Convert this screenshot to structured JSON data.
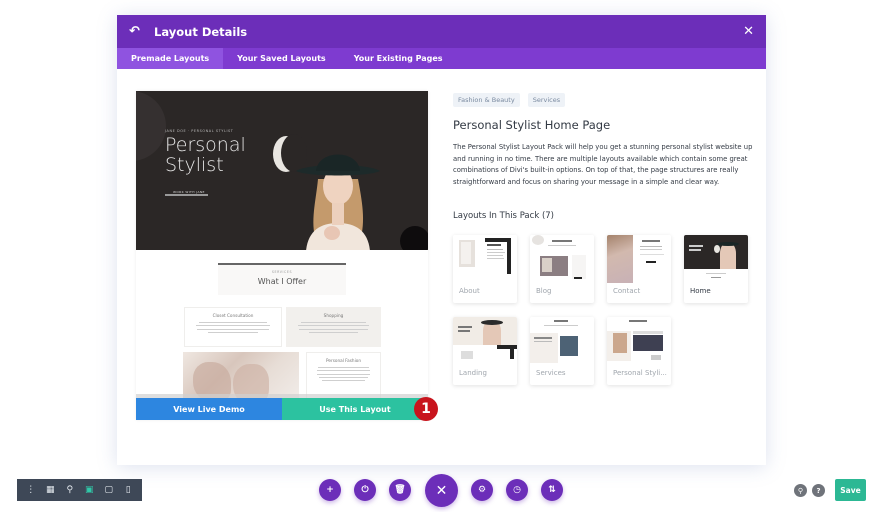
{
  "modal": {
    "title": "Layout Details",
    "back_icon": "back-arrow-icon",
    "close_icon": "close-icon",
    "tabs": [
      {
        "label": "Premade Layouts",
        "active": true
      },
      {
        "label": "Your Saved Layouts",
        "active": false
      },
      {
        "label": "Your Existing Pages",
        "active": false
      }
    ]
  },
  "preview": {
    "hero": {
      "kicker": "JANE DOE · PERSONAL STYLIST",
      "heading_line1": "Personal",
      "heading_line2": "Stylist",
      "cta": "WORK WITH JANE"
    },
    "services": {
      "kicker": "SERVICES",
      "heading": "What I Offer",
      "cards": [
        {
          "title": "Closet Consultation"
        },
        {
          "title": "Shopping"
        },
        {
          "title": "Personal Fashion"
        }
      ]
    },
    "buttons": {
      "view_demo": "View Live Demo",
      "use_layout": "Use This Layout"
    },
    "step_badge": "1"
  },
  "details": {
    "tags": [
      "Fashion & Beauty",
      "Services"
    ],
    "title": "Personal Stylist Home Page",
    "description": "The Personal Stylist Layout Pack will help you get a stunning personal stylist website up and running in no time. There are multiple layouts available which contain some great combinations of Divi's built-in options. On top of that, the page structures are really straightforward and focus on sharing your message in a simple and clear way.",
    "pack_title": "Layouts In This Pack (7)",
    "layouts": [
      {
        "label": "About",
        "active": false
      },
      {
        "label": "Blog",
        "active": false
      },
      {
        "label": "Contact",
        "active": false
      },
      {
        "label": "Home",
        "active": true
      },
      {
        "label": "Landing",
        "active": false
      },
      {
        "label": "Services",
        "active": false
      },
      {
        "label": "Personal Styli...",
        "active": false
      }
    ]
  },
  "bottom_bar": {
    "device_icons": [
      "more-vertical-icon",
      "wireframe-icon",
      "zoom-icon",
      "desktop-icon",
      "tablet-icon",
      "phone-icon"
    ],
    "active_device": "desktop-icon",
    "action_icons": [
      "add-icon",
      "power-icon",
      "trash-icon",
      "close-icon",
      "gear-icon",
      "history-icon",
      "sort-icon"
    ],
    "help_icons": [
      "search-icon",
      "help-icon"
    ],
    "save_label": "Save"
  },
  "colors": {
    "header_purple": "#6c2eb9",
    "tabs_purple": "#7e3bd0",
    "demo_blue": "#2d86e0",
    "use_teal": "#2cc2a0",
    "save_green": "#2cb894",
    "badge_red": "#c8141d"
  }
}
